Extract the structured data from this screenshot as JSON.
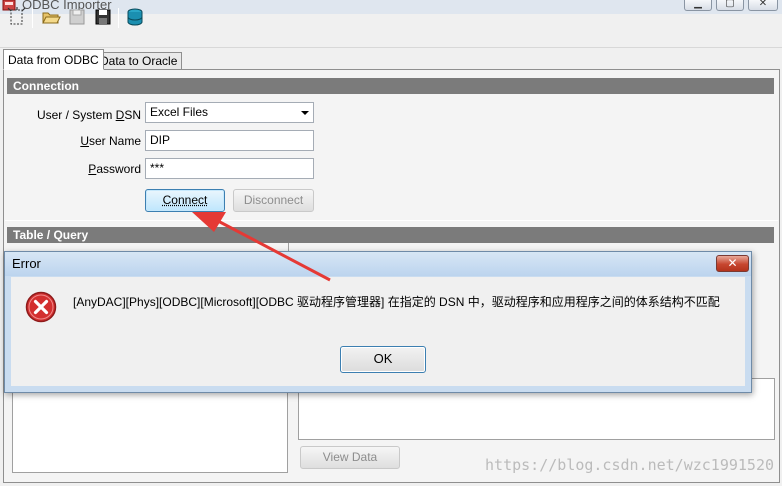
{
  "window": {
    "title": "ODBC Importer"
  },
  "tabs": [
    {
      "label": "Data from ODBC",
      "active": true
    },
    {
      "label": "Data to Oracle",
      "active": false
    }
  ],
  "connection": {
    "header": "Connection",
    "dsn_label_prefix": "User / System ",
    "dsn_label_key": "D",
    "dsn_label_rest": "SN",
    "dsn_value": "Excel Files",
    "username_label_key": "U",
    "username_label_rest": "ser Name",
    "username_value": "DIP",
    "password_label_key": "P",
    "password_label_rest": "assword",
    "password_value": "***",
    "connect_label": "Connect",
    "disconnect_label": "Disconnect"
  },
  "table_query": {
    "header": "Table / Query",
    "view_data_label": "View Data"
  },
  "dialog": {
    "title": "Error",
    "message": "[AnyDAC][Phys][ODBC][Microsoft][ODBC 驱动程序管理器] 在指定的 DSN 中，驱动程序和应用程序之间的体系结构不匹配",
    "ok_label": "OK"
  },
  "watermark": "https://blog.csdn.net/wzc1991520",
  "colors": {
    "accent": "#3c7fb1",
    "section_header": "#7b7b7b",
    "error_red": "#d32f2f",
    "arrow": "#e53935"
  },
  "icons": [
    "new-icon",
    "open-folder-icon",
    "save-icon",
    "save-as-icon",
    "database-icon",
    "error-icon",
    "close-icon"
  ]
}
